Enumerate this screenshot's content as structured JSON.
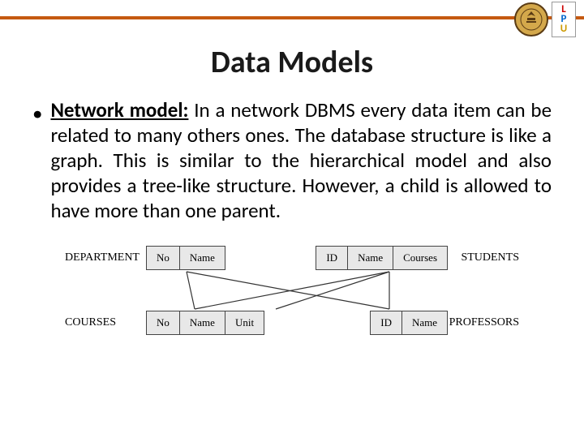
{
  "title": "Data Models",
  "bullet": {
    "lead": "Network model:",
    "body": " In a network DBMS every data item can be related to many others ones. The database structure is like a graph. This is similar to the hierarchical model and also provides a tree-like structure. However, a child is allowed to have more than one parent."
  },
  "logos": {
    "lpu": {
      "l": "L",
      "p": "P",
      "u": "U"
    }
  },
  "diagram": {
    "left_top_label": "DEPARTMENT",
    "right_top_label": "STUDENTS",
    "left_bot_label": "COURSES",
    "right_bot_label": "PROFESSORS",
    "dept": [
      "No",
      "Name"
    ],
    "students": [
      "ID",
      "Name",
      "Courses"
    ],
    "courses": [
      "No",
      "Name",
      "Unit"
    ],
    "professors": [
      "ID",
      "Name"
    ]
  }
}
